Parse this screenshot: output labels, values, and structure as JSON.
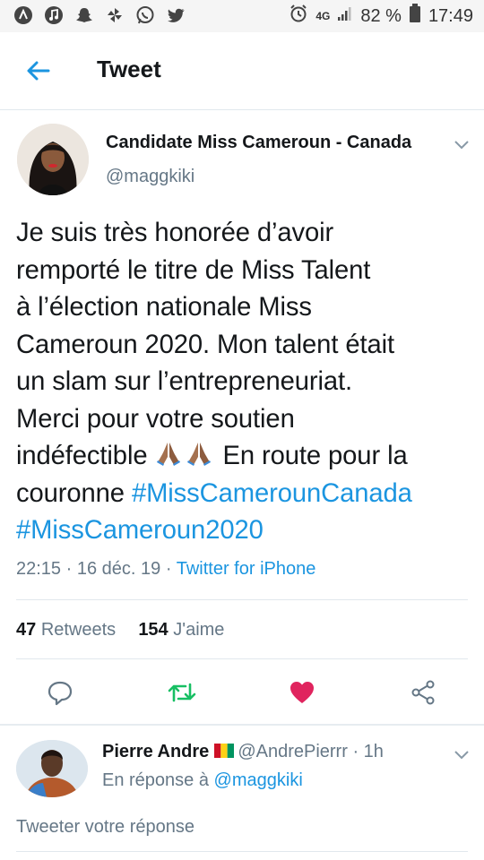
{
  "status_bar": {
    "battery_percent": "82 %",
    "time": "17:49",
    "network": "4G",
    "left_icons": [
      "app-icon",
      "music-icon",
      "snapchat-icon",
      "pinwheel-icon",
      "whatsapp-icon",
      "twitter-icon"
    ]
  },
  "header": {
    "title": "Tweet"
  },
  "tweet": {
    "author_name": "Candidate Miss Cameroun - Canada",
    "author_handle": "@maggkiki",
    "text_lines": [
      "Je suis très honorée d’avoir",
      "remporté le titre de Miss Talent",
      "à l’élection nationale Miss",
      "Cameroun 2020. Mon talent était",
      "un slam sur l’entrepreneuriat.",
      "Merci pour votre soutien"
    ],
    "text_before_emoji": "indéfectible",
    "emoji": "🙏🏾🙏🏾",
    "text_after_emoji": "En route pour la",
    "text_before_tag": "couronne",
    "hashtag1": "#MissCamerounCanada",
    "hashtag2": "#MissCameroun2020",
    "time": "22:15",
    "separator": "·",
    "date": "16 déc. 19",
    "source": "Twitter for iPhone",
    "retweets_count": "47",
    "retweets_label": "Retweets",
    "likes_count": "154",
    "likes_label": "J'aime"
  },
  "reply": {
    "name": "Pierre Andre",
    "flag": "guinea-flag",
    "handle": "@AndrePierrr",
    "time": "· 1h",
    "reply_prefix": "En réponse à",
    "reply_to": "@maggkiki"
  },
  "composer": {
    "placeholder": "Tweeter votre réponse"
  },
  "colors": {
    "accent": "#1b95e0",
    "retweet": "#17bf63",
    "like": "#e0245e",
    "muted": "#657786"
  }
}
